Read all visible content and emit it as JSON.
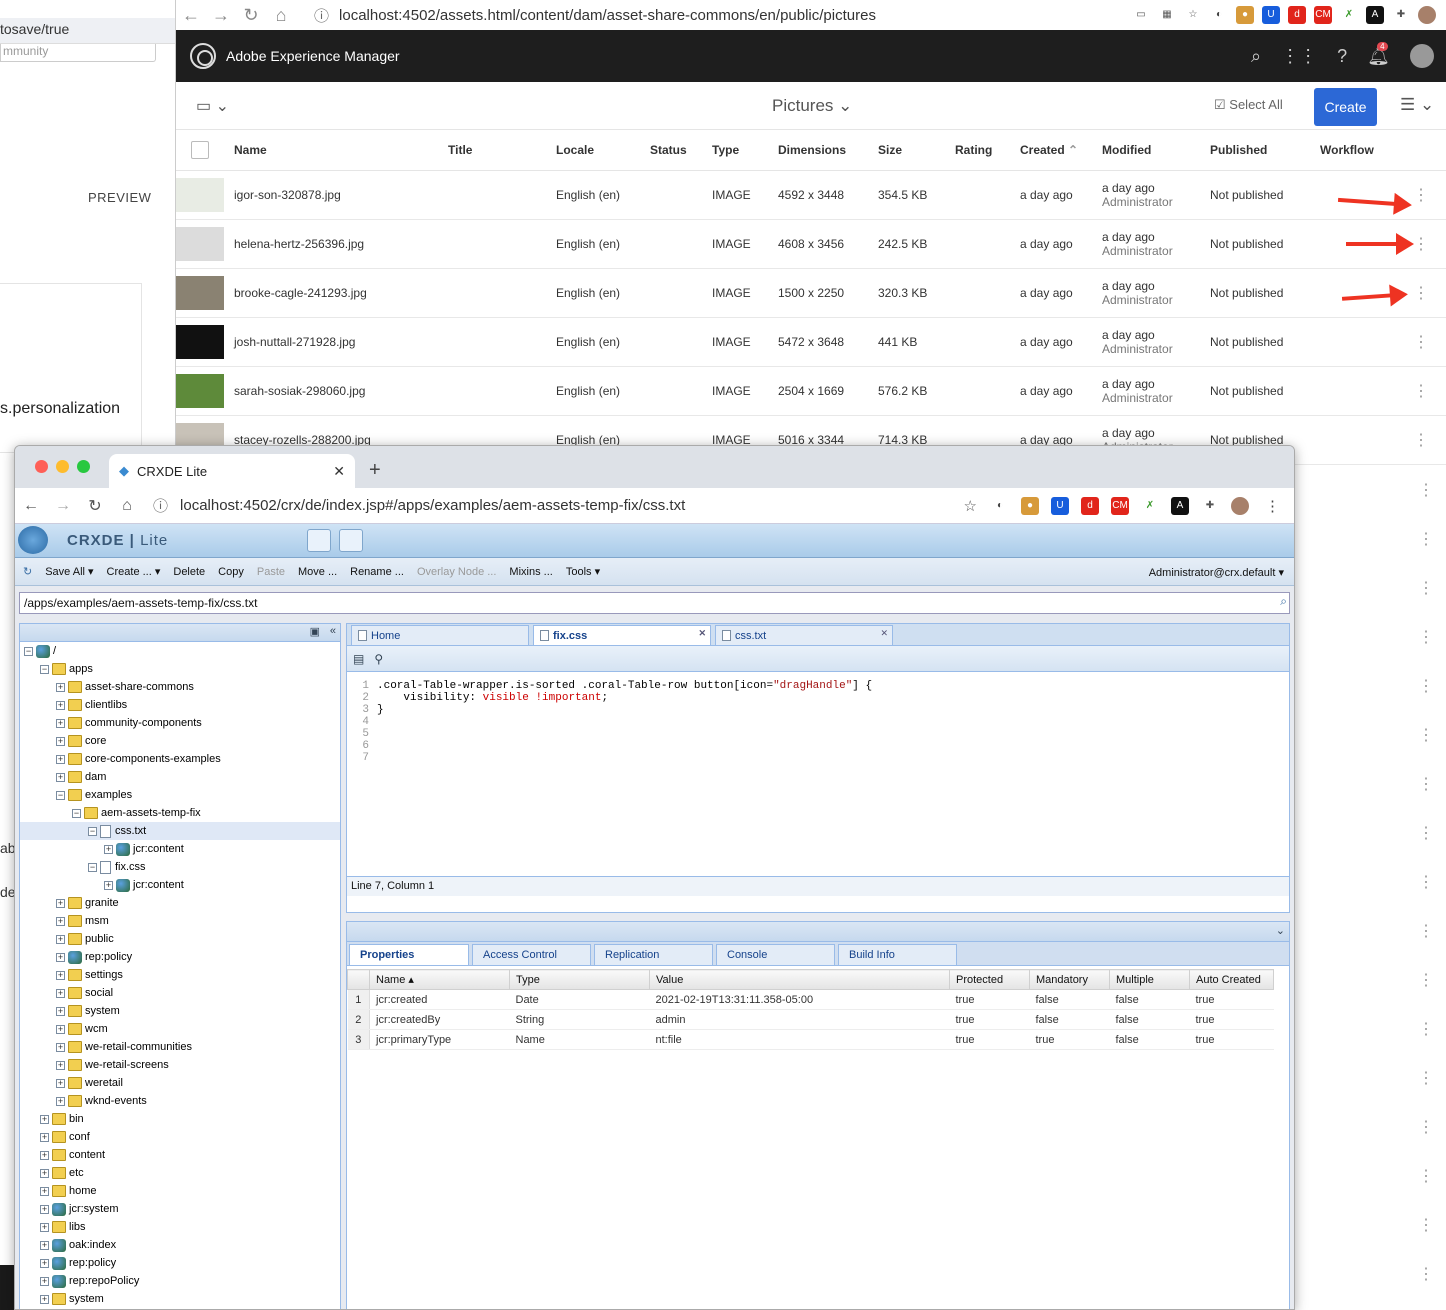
{
  "background_window": {
    "url_fragment": "tosave/true",
    "input_text": "mmunity",
    "preview_label": "PREVIEW",
    "personalization_text": "s.personalization",
    "side_letters": [
      "ab",
      "de"
    ]
  },
  "aem_browser": {
    "url": "localhost:4502/assets.html/content/dam/asset-share-commons/en/public/pictures",
    "product_name": "Adobe Experience Manager",
    "notification_count": "4",
    "folder_title": "Pictures",
    "select_all_label": "Select All",
    "create_label": "Create",
    "columns": [
      "Name",
      "Title",
      "Locale",
      "Status",
      "Type",
      "Dimensions",
      "Size",
      "Rating",
      "Created",
      "Modified",
      "Published",
      "Workflow"
    ],
    "rows": [
      {
        "name": "igor-son-320878.jpg",
        "locale": "English (en)",
        "type": "IMAGE",
        "dimensions": "4592 x 3448",
        "size": "354.5 KB",
        "created": "a day ago",
        "modified": "a day ago",
        "modified_by": "Administrator",
        "published": "Not published",
        "thumb_color": "#e8ece4"
      },
      {
        "name": "helena-hertz-256396.jpg",
        "locale": "English (en)",
        "type": "IMAGE",
        "dimensions": "4608 x 3456",
        "size": "242.5 KB",
        "created": "a day ago",
        "modified": "a day ago",
        "modified_by": "Administrator",
        "published": "Not published",
        "thumb_color": "#dcdcdc"
      },
      {
        "name": "brooke-cagle-241293.jpg",
        "locale": "English (en)",
        "type": "IMAGE",
        "dimensions": "1500 x 2250",
        "size": "320.3 KB",
        "created": "a day ago",
        "modified": "a day ago",
        "modified_by": "Administrator",
        "published": "Not published",
        "thumb_color": "#8a8272"
      },
      {
        "name": "josh-nuttall-271928.jpg",
        "locale": "English (en)",
        "type": "IMAGE",
        "dimensions": "5472 x 3648",
        "size": "441 KB",
        "created": "a day ago",
        "modified": "a day ago",
        "modified_by": "Administrator",
        "published": "Not published",
        "thumb_color": "#111111"
      },
      {
        "name": "sarah-sosiak-298060.jpg",
        "locale": "English (en)",
        "type": "IMAGE",
        "dimensions": "2504 x 1669",
        "size": "576.2 KB",
        "created": "a day ago",
        "modified": "a day ago",
        "modified_by": "Administrator",
        "published": "Not published",
        "thumb_color": "#5e8a3a"
      },
      {
        "name": "stacey-rozells-288200.jpg",
        "locale": "English (en)",
        "type": "IMAGE",
        "dimensions": "5016 x 3344",
        "size": "714.3 KB",
        "created": "a day ago",
        "modified": "a day ago",
        "modified_by": "Administrator",
        "published": "Not published",
        "thumb_color": "#c8c2b8"
      }
    ],
    "arrow_color": "#ee3322"
  },
  "crxde": {
    "tab_title": "CRXDE Lite",
    "url": "localhost:4502/crx/de/index.jsp#/apps/examples/aem-assets-temp-fix/css.txt",
    "brand": "CRXDE",
    "brand_suffix": "Lite",
    "toolbar": {
      "save_all": "Save All",
      "create": "Create ...",
      "delete": "Delete",
      "copy": "Copy",
      "paste": "Paste",
      "move": "Move ...",
      "rename": "Rename ...",
      "overlay": "Overlay Node ...",
      "mixins": "Mixins ...",
      "tools": "Tools",
      "user": "Administrator@crx.default"
    },
    "path": "/apps/examples/aem-assets-temp-fix/css.txt",
    "tree": [
      {
        "label": "/",
        "depth": 0,
        "kind": "jcr",
        "pm": "−"
      },
      {
        "label": "apps",
        "depth": 1,
        "kind": "folder",
        "pm": "−"
      },
      {
        "label": "asset-share-commons",
        "depth": 2,
        "kind": "folder",
        "pm": "+"
      },
      {
        "label": "clientlibs",
        "depth": 2,
        "kind": "folder",
        "pm": "+"
      },
      {
        "label": "community-components",
        "depth": 2,
        "kind": "folder",
        "pm": "+"
      },
      {
        "label": "core",
        "depth": 2,
        "kind": "folder",
        "pm": "+"
      },
      {
        "label": "core-components-examples",
        "depth": 2,
        "kind": "folder",
        "pm": "+"
      },
      {
        "label": "dam",
        "depth": 2,
        "kind": "folder",
        "pm": "+"
      },
      {
        "label": "examples",
        "depth": 2,
        "kind": "folder",
        "pm": "−"
      },
      {
        "label": "aem-assets-temp-fix",
        "depth": 3,
        "kind": "folder",
        "pm": "−"
      },
      {
        "label": "css.txt",
        "depth": 4,
        "kind": "file",
        "pm": "−",
        "selected": true
      },
      {
        "label": "jcr:content",
        "depth": 5,
        "kind": "jcr",
        "pm": "+"
      },
      {
        "label": "fix.css",
        "depth": 4,
        "kind": "file",
        "pm": "−"
      },
      {
        "label": "jcr:content",
        "depth": 5,
        "kind": "jcr",
        "pm": "+"
      },
      {
        "label": "granite",
        "depth": 2,
        "kind": "folder",
        "pm": "+"
      },
      {
        "label": "msm",
        "depth": 2,
        "kind": "folder",
        "pm": "+"
      },
      {
        "label": "public",
        "depth": 2,
        "kind": "folder",
        "pm": "+"
      },
      {
        "label": "rep:policy",
        "depth": 2,
        "kind": "jcr",
        "pm": "+"
      },
      {
        "label": "settings",
        "depth": 2,
        "kind": "folder",
        "pm": "+"
      },
      {
        "label": "social",
        "depth": 2,
        "kind": "folder",
        "pm": "+"
      },
      {
        "label": "system",
        "depth": 2,
        "kind": "folder",
        "pm": "+"
      },
      {
        "label": "wcm",
        "depth": 2,
        "kind": "folder",
        "pm": "+"
      },
      {
        "label": "we-retail-communities",
        "depth": 2,
        "kind": "folder",
        "pm": "+"
      },
      {
        "label": "we-retail-screens",
        "depth": 2,
        "kind": "folder",
        "pm": "+"
      },
      {
        "label": "weretail",
        "depth": 2,
        "kind": "folder",
        "pm": "+"
      },
      {
        "label": "wknd-events",
        "depth": 2,
        "kind": "folder",
        "pm": "+"
      },
      {
        "label": "bin",
        "depth": 1,
        "kind": "folder",
        "pm": "+"
      },
      {
        "label": "conf",
        "depth": 1,
        "kind": "folder",
        "pm": "+"
      },
      {
        "label": "content",
        "depth": 1,
        "kind": "folder",
        "pm": "+"
      },
      {
        "label": "etc",
        "depth": 1,
        "kind": "folder",
        "pm": "+"
      },
      {
        "label": "home",
        "depth": 1,
        "kind": "folder",
        "pm": "+"
      },
      {
        "label": "jcr:system",
        "depth": 1,
        "kind": "jcr",
        "pm": "+"
      },
      {
        "label": "libs",
        "depth": 1,
        "kind": "folder",
        "pm": "+"
      },
      {
        "label": "oak:index",
        "depth": 1,
        "kind": "jcr",
        "pm": "+"
      },
      {
        "label": "rep:policy",
        "depth": 1,
        "kind": "jcr",
        "pm": "+"
      },
      {
        "label": "rep:repoPolicy",
        "depth": 1,
        "kind": "jcr",
        "pm": "+"
      },
      {
        "label": "system",
        "depth": 1,
        "kind": "folder",
        "pm": "+"
      }
    ],
    "editor_tabs": [
      "Home",
      "fix.css",
      "css.txt"
    ],
    "active_editor_tab": "fix.css",
    "code_line_numbers": [
      "1",
      "2",
      "3",
      "4",
      "5",
      "6",
      "7"
    ],
    "code": {
      "selector": ".coral-Table-wrapper.is-sorted .coral-Table-row button[icon=",
      "selector_string": "\"dragHandle\"",
      "selector_end": "] {",
      "prop_indent": "    visibility: ",
      "prop_value": "visible",
      "prop_important": " !important",
      "prop_end": ";",
      "close": "}"
    },
    "status": "Line 7, Column 1",
    "prop_tabs": [
      "Properties",
      "Access Control",
      "Replication",
      "Console",
      "Build Info"
    ],
    "prop_columns": [
      "Name ▴",
      "Type",
      "Value",
      "Protected",
      "Mandatory",
      "Multiple",
      "Auto Created"
    ],
    "properties": [
      {
        "n": "1",
        "name": "jcr:created",
        "type": "Date",
        "value": "2021-02-19T13:31:11.358-05:00",
        "protected": "true",
        "mandatory": "false",
        "multiple": "false",
        "auto": "true"
      },
      {
        "n": "2",
        "name": "jcr:createdBy",
        "type": "String",
        "value": "admin",
        "protected": "true",
        "mandatory": "false",
        "multiple": "false",
        "auto": "true"
      },
      {
        "n": "3",
        "name": "jcr:primaryType",
        "type": "Name",
        "value": "nt:file",
        "protected": "true",
        "mandatory": "true",
        "multiple": "false",
        "auto": "true"
      }
    ]
  }
}
